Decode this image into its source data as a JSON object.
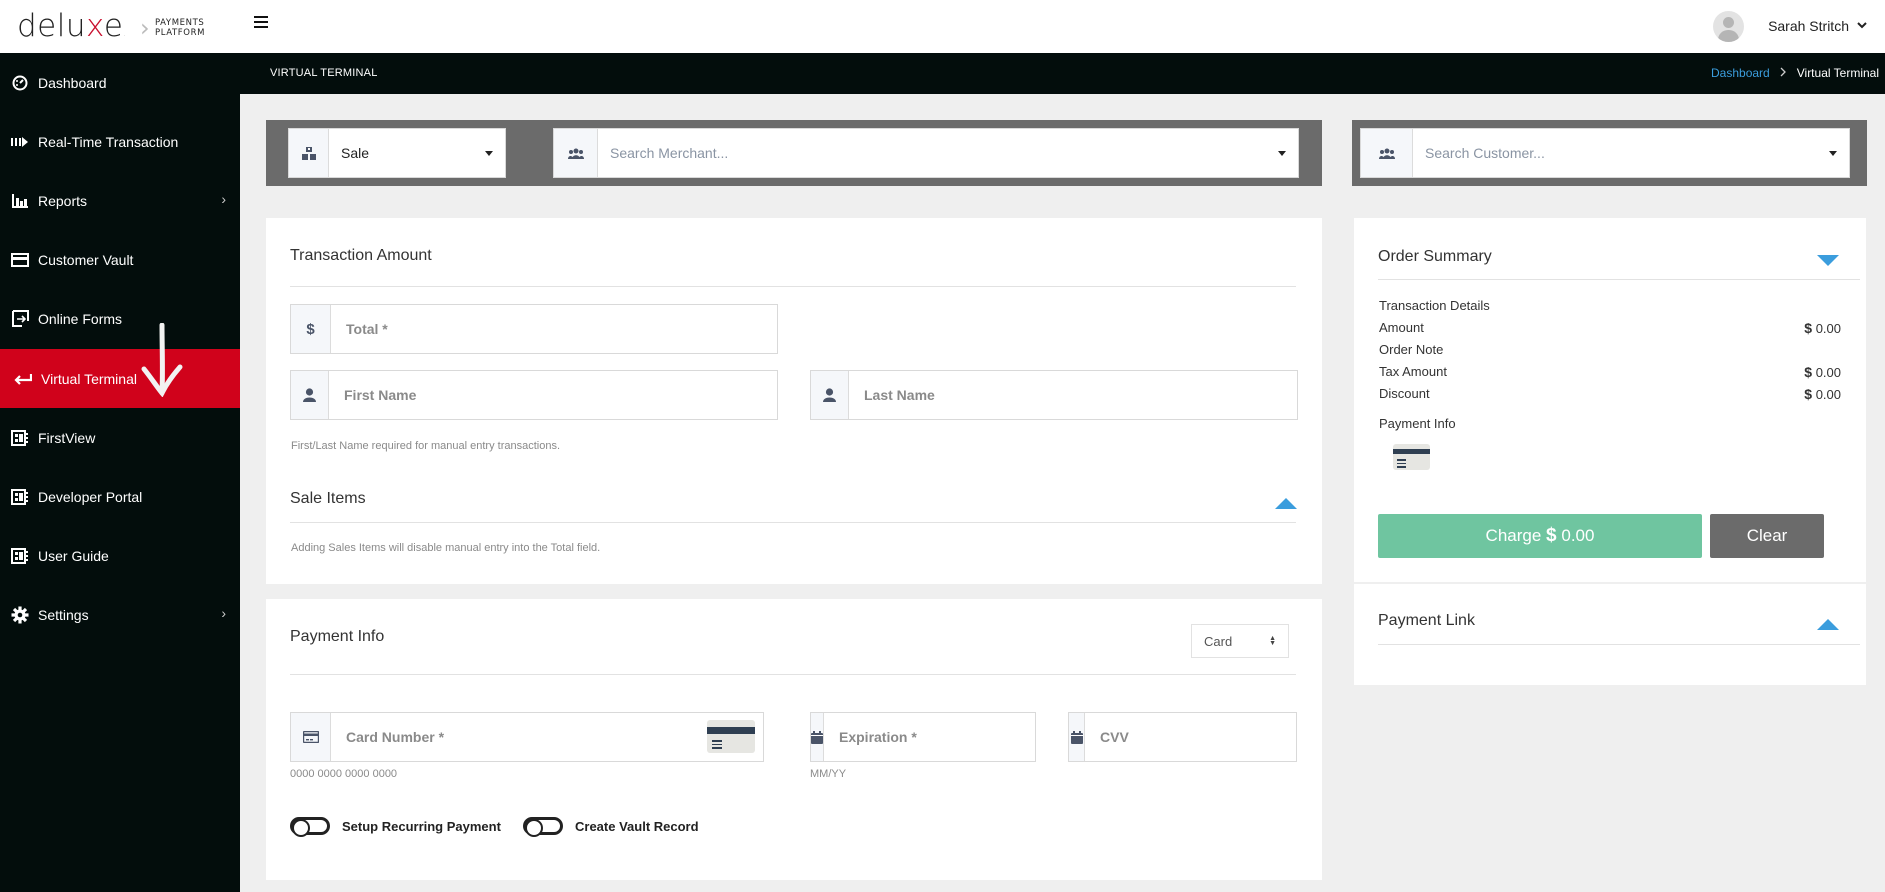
{
  "header": {
    "logo_text_pre": "delu",
    "logo_text_x": "x",
    "logo_text_post": "e",
    "logo_sub_line1": "PAYMENTS",
    "logo_sub_line2": "PLATFORM",
    "user_name": "Sarah Stritch"
  },
  "sidebar": {
    "items": [
      {
        "label": "Dashboard",
        "icon": "dashboard-icon"
      },
      {
        "label": "Real-Time Transaction",
        "icon": "realtime-icon"
      },
      {
        "label": "Reports",
        "icon": "reports-icon",
        "has_submenu": true
      },
      {
        "label": "Customer Vault",
        "icon": "vault-icon"
      },
      {
        "label": "Online Forms",
        "icon": "forms-icon"
      },
      {
        "label": "Virtual Terminal",
        "icon": "return-arrow-icon",
        "active": true
      },
      {
        "label": "FirstView",
        "icon": "document-icon"
      },
      {
        "label": "Developer Portal",
        "icon": "document-icon"
      },
      {
        "label": "User Guide",
        "icon": "document-icon"
      },
      {
        "label": "Settings",
        "icon": "gear-icon",
        "has_submenu": true
      }
    ]
  },
  "subheader": {
    "title": "VIRTUAL TERMINAL",
    "breadcrumb": [
      {
        "label": "Dashboard",
        "link": true
      },
      {
        "label": "Virtual Terminal",
        "link": false
      }
    ]
  },
  "selectors": {
    "transaction_type": "Sale",
    "merchant_placeholder": "Search Merchant...",
    "customer_placeholder": "Search Customer..."
  },
  "transaction_amount": {
    "title": "Transaction Amount",
    "total_placeholder": "Total *",
    "first_name_placeholder": "First Name",
    "last_name_placeholder": "Last Name",
    "name_hint": "First/Last Name required for manual entry transactions.",
    "sale_items_title": "Sale Items",
    "sale_items_hint": "Adding Sales Items will disable manual entry into the Total field."
  },
  "payment_info": {
    "title": "Payment Info",
    "method": "Card",
    "card_number_placeholder": "Card Number *",
    "card_number_hint": "0000 0000 0000 0000",
    "expiration_placeholder": "Expiration *",
    "expiration_hint": "MM/YY",
    "cvv_placeholder": "CVV",
    "recurring_label": "Setup Recurring Payment",
    "vault_label": "Create Vault Record"
  },
  "order_summary": {
    "title": "Order Summary",
    "section_label": "Transaction Details",
    "rows": [
      {
        "label": "Amount",
        "currency": "$",
        "value": "0.00"
      },
      {
        "label": "Order Note",
        "currency": "",
        "value": ""
      },
      {
        "label": "Tax Amount",
        "currency": "$",
        "value": "0.00"
      },
      {
        "label": "Discount",
        "currency": "$",
        "value": "0.00"
      }
    ],
    "payment_info_label": "Payment Info",
    "charge_label": "Charge",
    "charge_currency": "$",
    "charge_amount": "0.00",
    "clear_label": "Clear"
  },
  "payment_link": {
    "title": "Payment Link"
  },
  "colors": {
    "brand_red": "#d0021b",
    "sidebar_bg": "#030d0c",
    "accent_blue": "#3b9ddd",
    "charge_green": "#6fc5a0",
    "clear_gray": "#6b6b6b"
  }
}
